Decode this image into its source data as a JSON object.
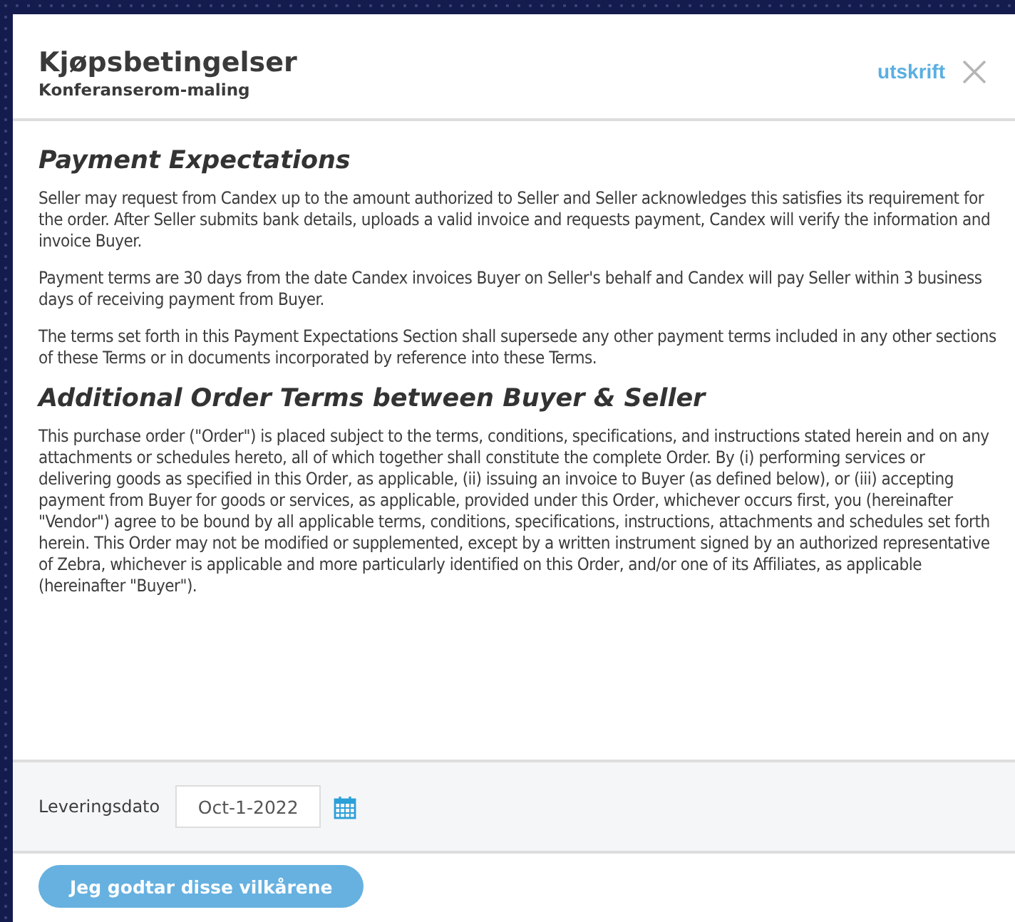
{
  "dialog": {
    "title": "Kjøpsbetingelser",
    "subtitle": "Konferanserom-maling",
    "print_link": "utskrift"
  },
  "sections": [
    {
      "heading": "Payment Expectations",
      "paragraphs": [
        "Seller may request from Candex up to the amount authorized to Seller and Seller acknowledges this satisfies its requirement for the order. After Seller submits bank details, uploads a valid invoice and requests payment, Candex will verify the information and invoice Buyer.",
        "Payment terms are 30 days from the date Candex invoices Buyer on Seller's behalf and Candex will pay Seller within 3 business days of receiving payment from Buyer.",
        "The terms set forth in this Payment Expectations Section shall supersede any other payment terms included in any other sections of these Terms or in documents incorporated by reference into these Terms."
      ]
    },
    {
      "heading": "Additional Order Terms between Buyer & Seller",
      "paragraphs": [
        "This purchase order (\"Order\") is placed subject to the terms, conditions, specifications, and instructions stated herein and on any attachments or schedules hereto, all of which together shall constitute the complete Order. By (i) performing services or delivering goods as specified in this Order, as applicable, (ii) issuing an invoice to Buyer (as defined below), or (iii) accepting payment from Buyer for goods or services, as applicable, provided under this Order, whichever occurs first, you (hereinafter \"Vendor\") agree to be bound by all applicable terms, conditions, specifications, instructions, attachments and schedules set forth herein. This Order may not be modified or supplemented, except by a written instrument signed by an authorized representative of Zebra, whichever is applicable and more particularly identified on this Order, and/or one of its Affiliates, as applicable (hereinafter \"Buyer\")."
      ]
    }
  ],
  "delivery": {
    "label": "Leveringsdato",
    "value": "Oct-1-2022"
  },
  "accept_button": "Jeg godtar disse vilkårene"
}
